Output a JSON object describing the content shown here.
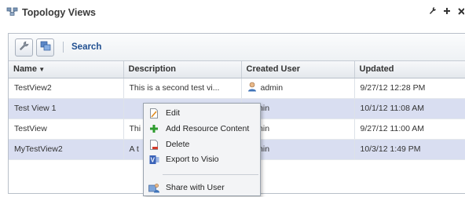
{
  "header": {
    "title": "Topology Views",
    "icons": [
      "topology-icon",
      "wrench-icon",
      "plus-icon",
      "close-icon"
    ]
  },
  "toolbar": {
    "search_label": "Search"
  },
  "table": {
    "columns": [
      "Name",
      "Description",
      "Created User",
      "Updated"
    ],
    "sorted_column": "Name",
    "rows": [
      {
        "name": "TestView2",
        "description": "This is a second test vi...",
        "created_user": "admin",
        "updated": "9/27/12 12:28 PM",
        "selected": false
      },
      {
        "name": "Test View 1",
        "description": "",
        "created_user": "admin",
        "updated": "10/1/12 11:08 AM",
        "selected": true
      },
      {
        "name": "TestView",
        "description": "Thi",
        "created_user": "admin",
        "updated": "9/27/12 11:00 AM",
        "selected": false
      },
      {
        "name": "MyTestView2",
        "description": "A t",
        "created_user": "admin",
        "updated": "10/3/12 1:49 PM",
        "selected": true
      }
    ]
  },
  "context_menu": {
    "items": [
      {
        "label": "Edit",
        "icon": "edit-icon"
      },
      {
        "label": "Add Resource Content",
        "icon": "add-icon"
      },
      {
        "label": "Delete",
        "icon": "delete-icon"
      },
      {
        "label": "Export to Visio",
        "icon": "visio-icon"
      },
      {
        "label": "Share with User",
        "icon": "share-icon"
      }
    ]
  }
}
